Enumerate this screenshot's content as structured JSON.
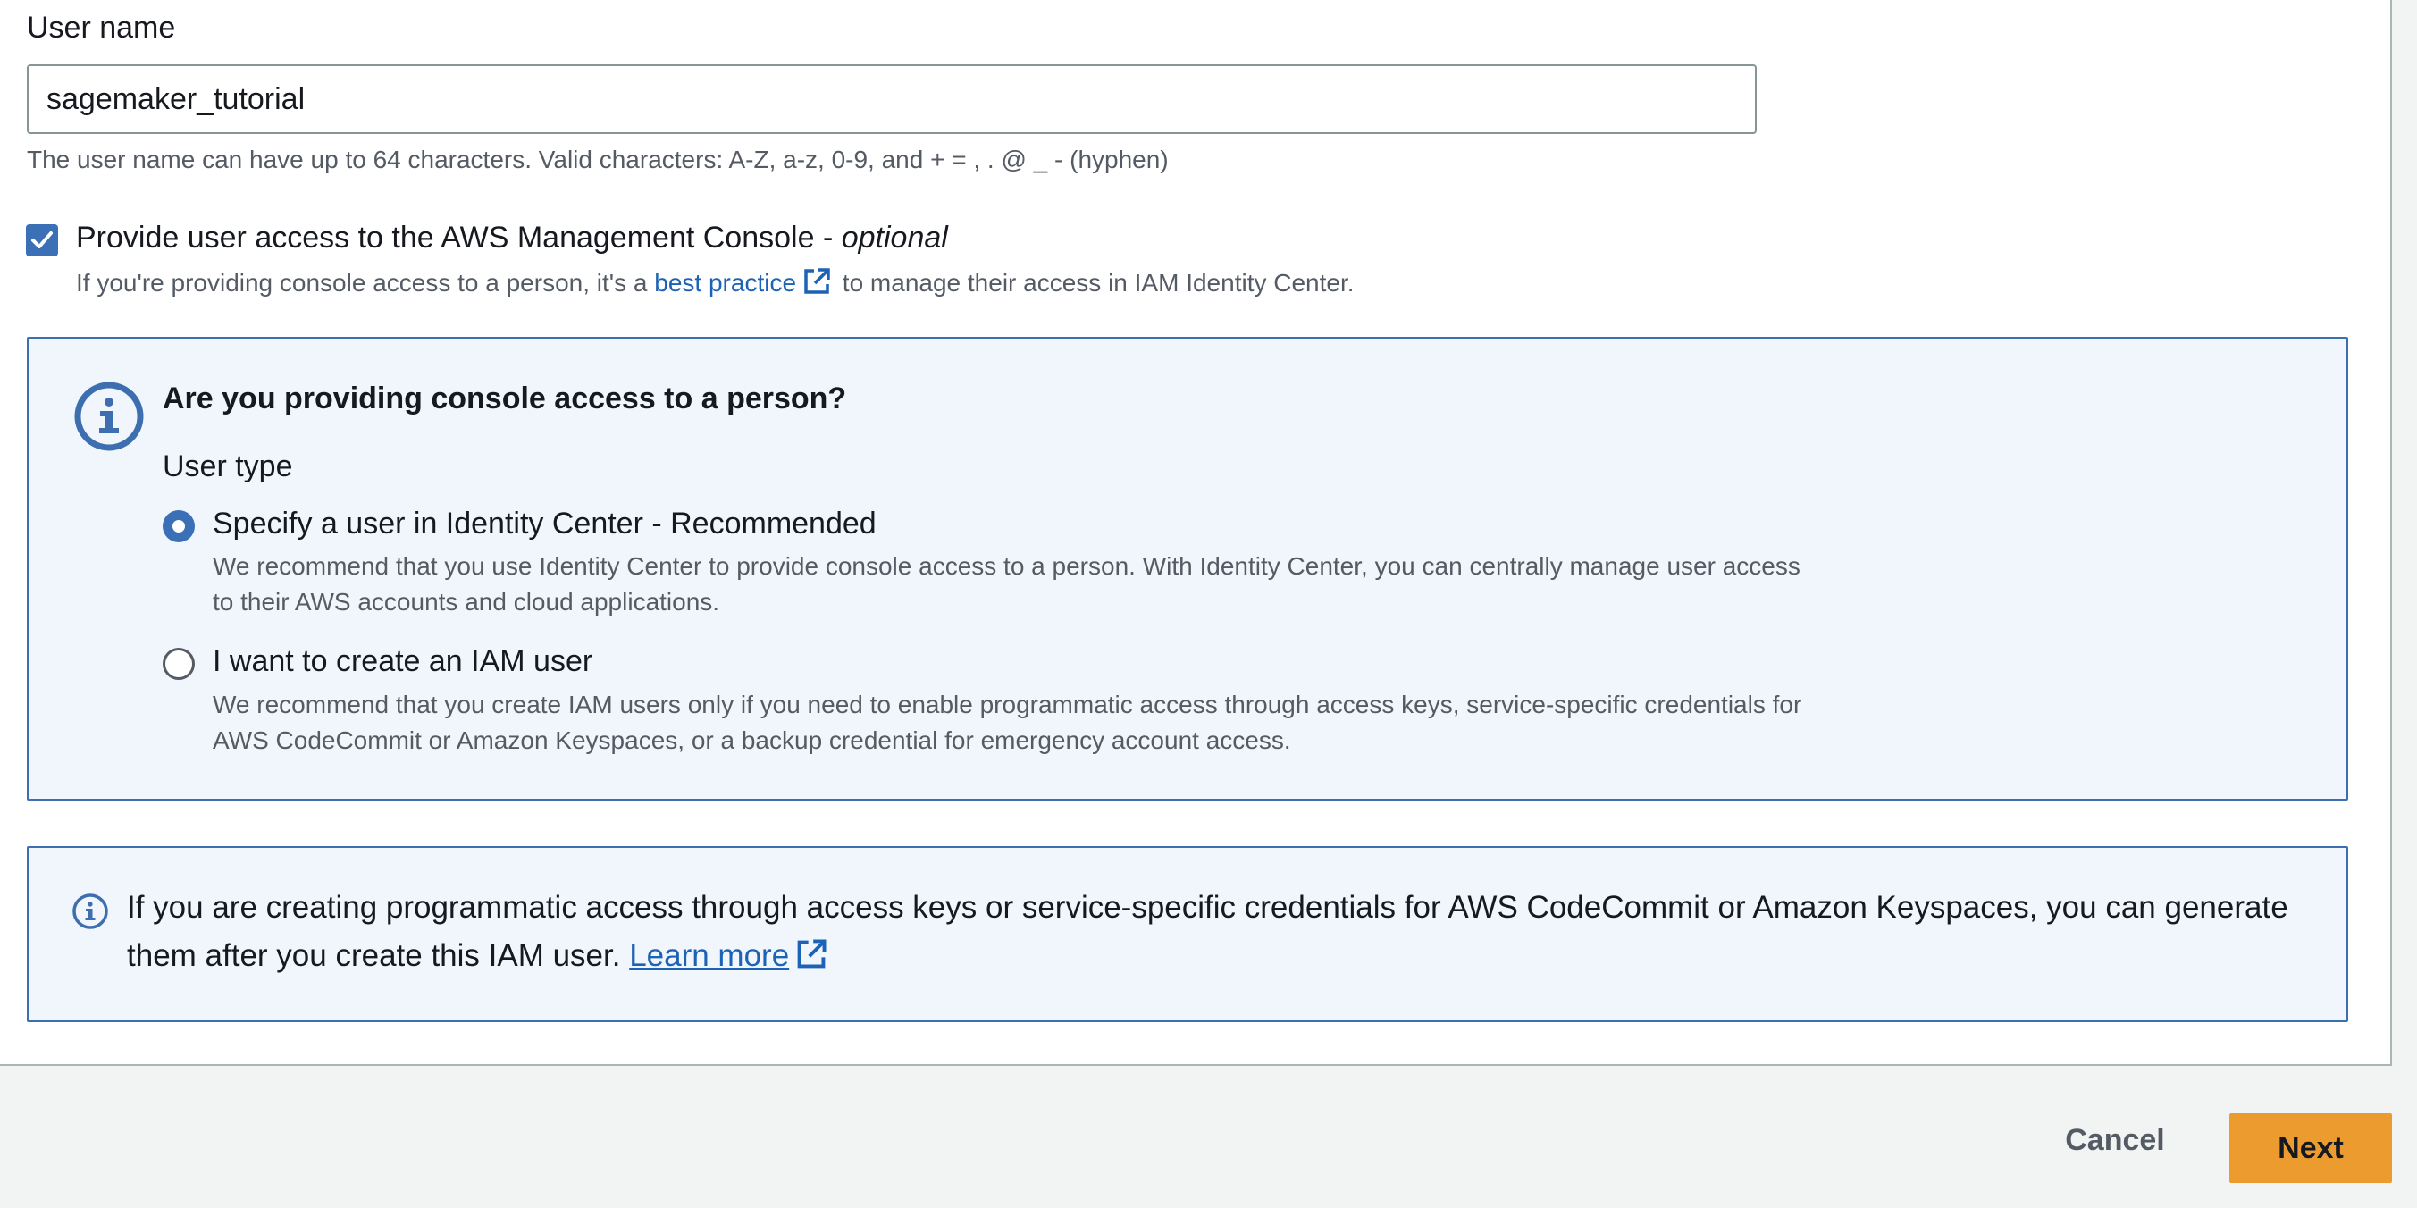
{
  "user_name": {
    "label": "User name",
    "value": "sagemaker_tutorial",
    "hint": "The user name can have up to 64 characters. Valid characters: A-Z, a-z, 0-9, and + = , . @ _ - (hyphen)"
  },
  "console_access": {
    "checked": true,
    "label": "Provide user access to the AWS Management Console - ",
    "label_optional": "optional",
    "desc_before": "If you're providing console access to a person, it's a ",
    "desc_link": "best practice",
    "desc_after": " to manage their access in IAM Identity Center."
  },
  "person_panel": {
    "title": "Are you providing console access to a person?",
    "user_type_label": "User type",
    "options": [
      {
        "label": "Specify a user in Identity Center - Recommended",
        "description": "We recommend that you use Identity Center to provide console access to a person. With Identity Center, you can centrally manage user access to their AWS accounts and cloud applications.",
        "selected": true
      },
      {
        "label": "I want to create an IAM user",
        "description": "We recommend that you create IAM users only if you need to enable programmatic access through access keys, service-specific credentials for AWS CodeCommit or Amazon Keyspaces, or a backup credential for emergency account access.",
        "selected": false
      }
    ]
  },
  "programmatic_panel": {
    "text": "If you are creating programmatic access through access keys or service-specific credentials for AWS CodeCommit or Amazon Keyspaces, you can generate them after you create this IAM user. ",
    "link": "Learn more"
  },
  "footer": {
    "cancel_label": "Cancel",
    "next_label": "Next"
  },
  "colors": {
    "accent": "#3b6fb6",
    "primary_button": "#ec9c2f",
    "panel_bg": "#f1f6fc"
  }
}
